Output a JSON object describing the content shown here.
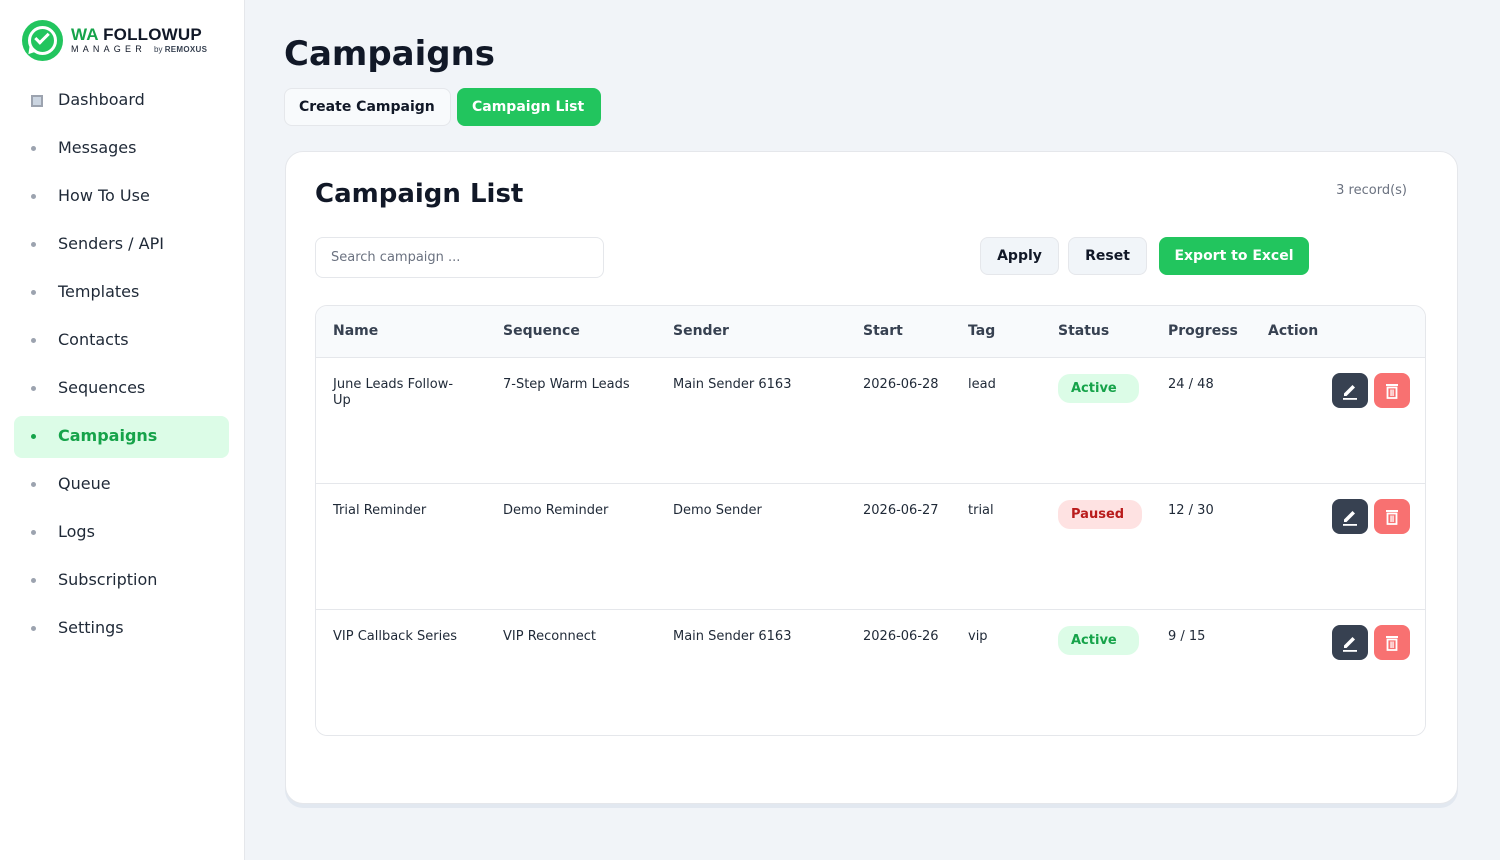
{
  "brand": {
    "name_prefix": "WA",
    "name_main": " FOLLOWUP",
    "subtitle": "MANAGER",
    "by": "by",
    "company": "REMOXUS"
  },
  "nav": {
    "items": [
      {
        "label": "Dashboard",
        "icon": "dashboard-icon"
      },
      {
        "label": "Messages"
      },
      {
        "label": "How To Use"
      },
      {
        "label": "Senders / API"
      },
      {
        "label": "Templates"
      },
      {
        "label": "Contacts"
      },
      {
        "label": "Sequences"
      },
      {
        "label": "Campaigns",
        "active": true
      },
      {
        "label": "Queue"
      },
      {
        "label": "Logs"
      },
      {
        "label": "Subscription"
      },
      {
        "label": "Settings"
      }
    ]
  },
  "page": {
    "title": "Campaigns"
  },
  "tabs": {
    "create": "Create Campaign",
    "list": "Campaign List",
    "active": "list"
  },
  "card": {
    "title": "Campaign List",
    "record_count": "3 record(s)",
    "search_placeholder": "Search campaign ...",
    "apply": "Apply",
    "reset": "Reset",
    "export": "Export to Excel"
  },
  "table": {
    "headers": [
      "Name",
      "Sequence",
      "Sender",
      "Start",
      "Tag",
      "Status",
      "Progress",
      "Action"
    ],
    "rows": [
      {
        "name": "June Leads Follow-Up",
        "sequence": "7-Step Warm Leads",
        "sender": "Main Sender 6163",
        "start": "2026-06-28",
        "tag": "lead",
        "status": "Active",
        "progress": "24 / 48"
      },
      {
        "name": "Trial Reminder",
        "sequence": "Demo Reminder",
        "sender": "Demo Sender",
        "start": "2026-06-27",
        "tag": "trial",
        "status": "Paused",
        "progress": "12 / 30"
      },
      {
        "name": "VIP Callback Series",
        "sequence": "VIP Reconnect",
        "sender": "Main Sender 6163",
        "start": "2026-06-26",
        "tag": "vip",
        "status": "Active",
        "progress": "9 / 15"
      }
    ]
  },
  "colors": {
    "accent": "#22c55e",
    "accent_text": "#16a34a",
    "paused": "#b91c1c",
    "edit_button": "#374151",
    "delete_button": "#f87171"
  }
}
